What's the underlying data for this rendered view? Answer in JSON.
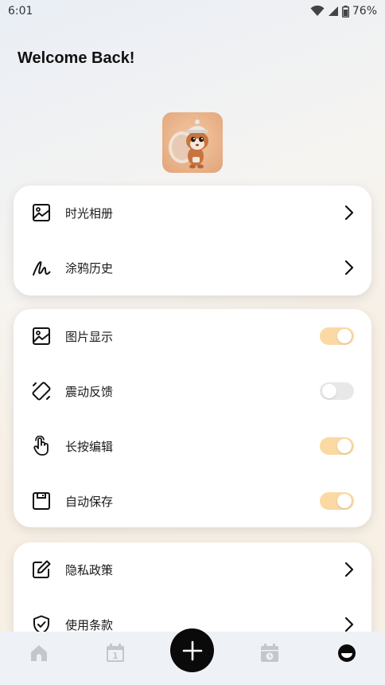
{
  "status_bar": {
    "time": "6:01",
    "battery": "76%"
  },
  "header": {
    "welcome": "Welcome Back!"
  },
  "card1": {
    "items": [
      {
        "label": "时光相册",
        "icon": "photo-icon"
      },
      {
        "label": "涂鸦历史",
        "icon": "scribble-icon"
      }
    ]
  },
  "card2": {
    "items": [
      {
        "label": "图片显示",
        "icon": "photo-icon",
        "enabled": true
      },
      {
        "label": "震动反馈",
        "icon": "vibration-icon",
        "enabled": false
      },
      {
        "label": "长按编辑",
        "icon": "touch-icon",
        "enabled": true
      },
      {
        "label": "自动保存",
        "icon": "save-icon",
        "enabled": true
      }
    ]
  },
  "card3": {
    "items": [
      {
        "label": "隐私政策",
        "icon": "edit-icon"
      },
      {
        "label": "使用条款",
        "icon": "shield-check-icon"
      }
    ]
  },
  "bottom_nav": {
    "items": [
      "home-icon",
      "calendar-icon",
      "add-icon",
      "schedule-icon",
      "profile-icon"
    ],
    "calendar_day": "1"
  },
  "colors": {
    "toggle_on": "#fbd9a3",
    "toggle_off": "#e8e8e8",
    "fab": "#0a0a0a"
  }
}
